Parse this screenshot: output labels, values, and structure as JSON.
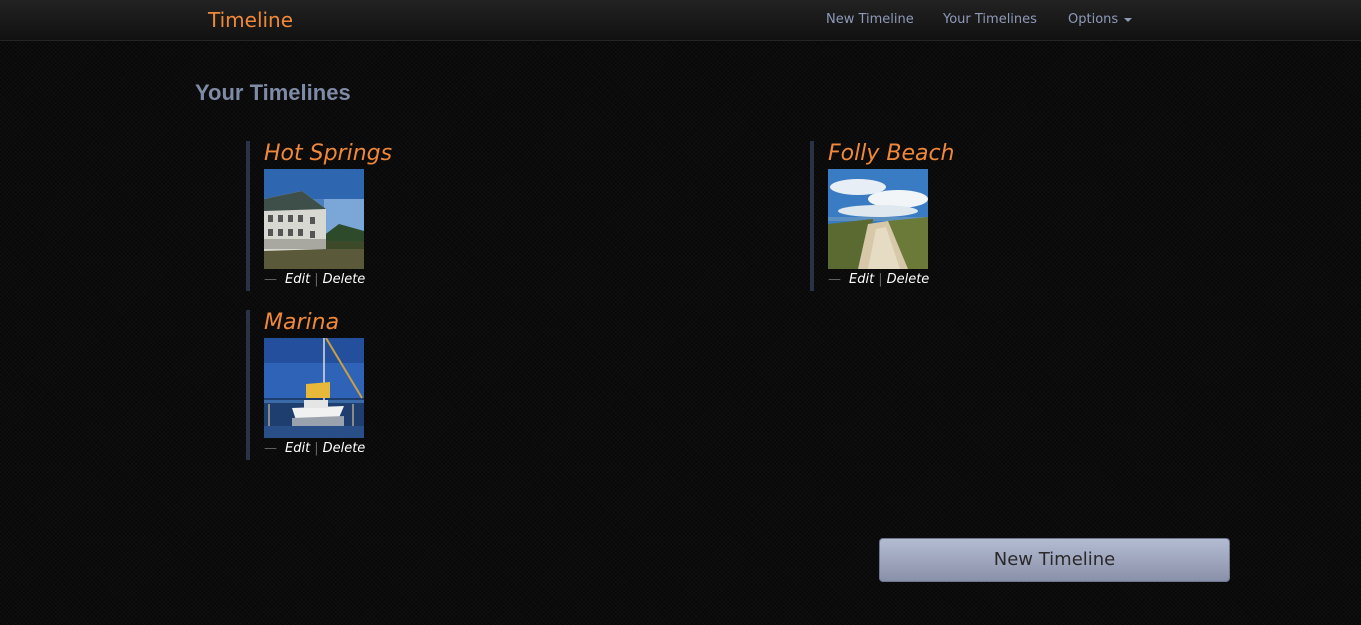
{
  "navbar": {
    "brand": "Timeline",
    "links": [
      "New Timeline",
      "Your Timelines",
      "Options"
    ]
  },
  "page": {
    "title": "Your Timelines"
  },
  "timelines": [
    {
      "title": "Hot Springs",
      "edit": "Edit",
      "delete": "Delete",
      "dash": "—",
      "sep": "|"
    },
    {
      "title": "Folly Beach",
      "edit": "Edit",
      "delete": "Delete",
      "dash": "—",
      "sep": "|"
    },
    {
      "title": "Marina",
      "edit": "Edit",
      "delete": "Delete",
      "dash": "—",
      "sep": "|"
    }
  ],
  "new_button": {
    "label": "New Timeline"
  },
  "icons": {
    "options_caret": "caret-down-icon"
  },
  "colors": {
    "accent": "#f0883a",
    "nav_text": "#8f9ab8",
    "title_text": "#7f8aa6",
    "card_border": "#2b3246",
    "button_bg": "#9aa2bb"
  }
}
